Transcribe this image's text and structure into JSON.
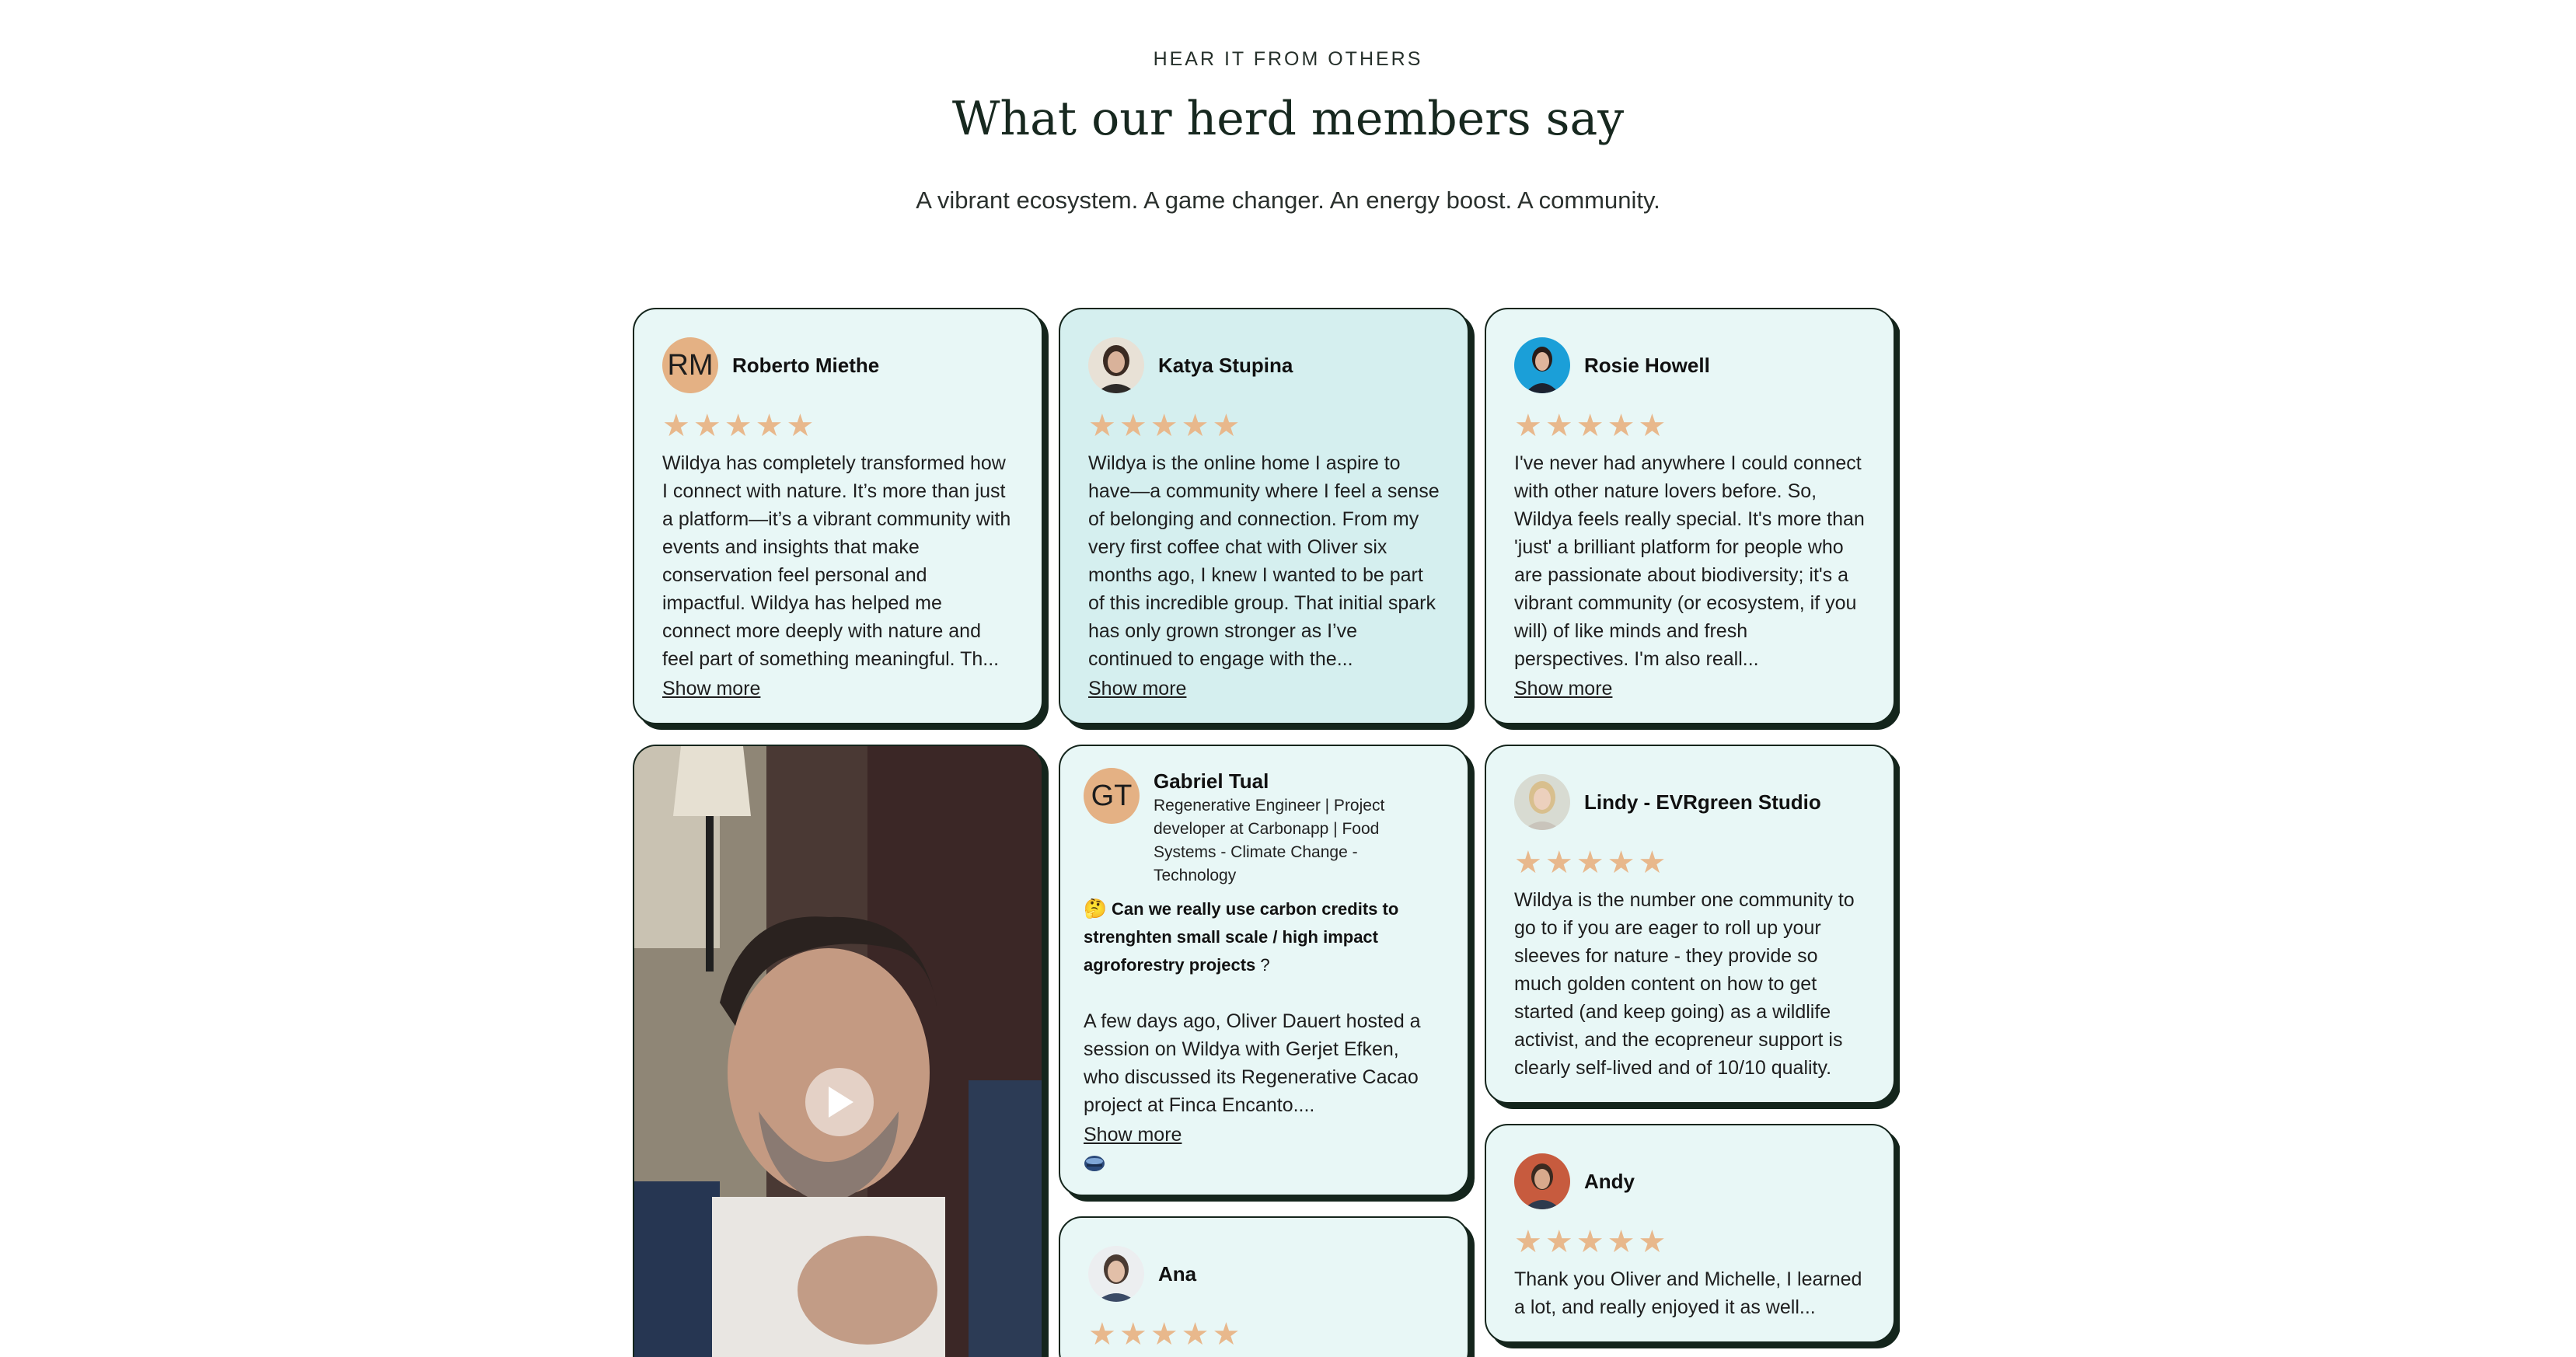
{
  "section": {
    "eyebrow": "HEAR IT FROM OTHERS",
    "title": "What our herd members say",
    "subtitle": "A vibrant ecosystem. A game changer. An energy boost. A community."
  },
  "colors": {
    "card_bg": "#e8f7f6",
    "card_bg_alt": "#d5efef",
    "card_border": "#14251c",
    "star": "#e8b88c",
    "initials_avatar": "#e4b184"
  },
  "reviews": {
    "roberto": {
      "initials": "RM",
      "name": "Roberto Miethe",
      "rating": 5,
      "stars": "★★★★★",
      "text": "Wildya has completely transformed how I connect with nature. It’s more than just a platform—it’s a vibrant community with events and insights that make conservation feel personal and impactful. Wildya has helped me connect more deeply with nature and feel part of something meaningful. Th...",
      "show_more": "Show more"
    },
    "katya": {
      "name": "Katya Stupina",
      "avatar_icon": "person-photo-icon",
      "rating": 5,
      "stars": "★★★★★",
      "text": "Wildya is the online home I aspire to have—a community where I feel a sense of belonging and connection. From my very first coffee chat with Oliver six months ago, I knew I wanted to be part of this incredible group. That initial spark has only grown stronger as I’ve continued to engage with the...",
      "show_more": "Show more"
    },
    "rosie": {
      "name": "Rosie Howell",
      "avatar_icon": "person-photo-icon",
      "rating": 5,
      "stars": "★★★★★",
      "text": "I've never had anywhere I could connect with other nature lovers before. So, Wildya feels really special. It's more than 'just' a brilliant platform for people who are passionate about biodiversity; it's a vibrant community (or ecosystem, if you will) of like minds and fresh perspectives. I'm also reall...",
      "show_more": "Show more"
    },
    "gabriel": {
      "initials": "GT",
      "name": "Gabriel Tual",
      "subtitle": "Regenerative Engineer | Project developer at Carbonapp | Food Systems - Climate Change - Technology",
      "hook_emoji": "🤔",
      "hook": "Can we really use carbon credits to strenghten small scale / high impact agroforestry projects",
      "hook_suffix": " ?",
      "text": "A few days ago, Oliver Dauert hosted a session on Wildya with Gerjet Efken, who discussed its Regenerative Cacao project at Finca Encanto....",
      "show_more": "Show more"
    },
    "lindy": {
      "name": "Lindy - EVRgreen Studio",
      "avatar_icon": "person-photo-icon",
      "rating": 5,
      "stars": "★★★★★",
      "text": "Wildya is the number one community to go to if you are eager to roll up your sleeves for nature - they provide so much golden content on how to get started (and keep going) as a wildlife activist, and the ecopreneur support is clearly self-lived and of 10/10 quality."
    },
    "ana": {
      "name": "Ana",
      "avatar_icon": "person-photo-icon",
      "rating": 5,
      "stars": "★★★★★"
    },
    "andy": {
      "name": "Andy",
      "avatar_icon": "person-photo-icon",
      "rating": 5,
      "stars": "★★★★★",
      "text": "Thank you Oliver and Michelle, I learned a lot, and really enjoyed it as well..."
    }
  },
  "video": {
    "play_icon": "play-icon"
  }
}
